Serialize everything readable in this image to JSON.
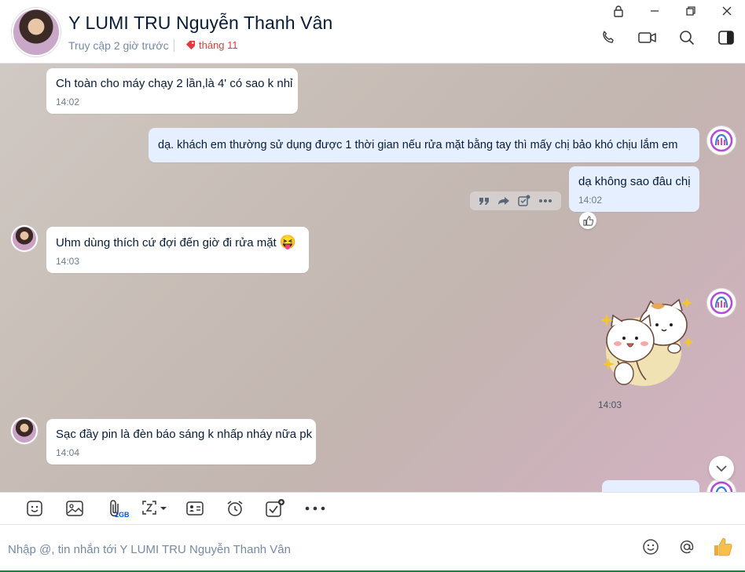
{
  "header": {
    "contact_name": "Y LUMI TRU Nguyễn Thanh Vân",
    "last_seen": "Truy cập 2 giờ trước",
    "tag_label": "tháng 11",
    "tag_color": "#e0393e"
  },
  "window_controls": [
    "lock-icon",
    "minimize-icon",
    "restore-icon",
    "close-icon"
  ],
  "header_actions": [
    "phone-icon",
    "video-call-icon",
    "search-icon",
    "sidebar-toggle-icon"
  ],
  "messages": [
    {
      "sender": "contact",
      "text": "Ch toàn cho máy chạy 2 lần,là 4' có sao k nhỉ",
      "time": "14:02"
    },
    {
      "sender": "me",
      "text": "dạ. khách em thường sử dụng được 1 thời gian nếu rửa mặt bằng tay thì mấy chị bảo khó chịu lắm em"
    },
    {
      "sender": "me",
      "text": "dạ không sao đâu chị",
      "time": "14:02",
      "reaction": "like-icon"
    },
    {
      "sender": "contact",
      "text": "Uhm dùng thích cứ đợi đến giờ đi rửa mặt",
      "emoji": "😝",
      "time": "14:03"
    },
    {
      "sender": "me",
      "type": "sticker",
      "sticker": "two-cats-sticker",
      "time": "14:03"
    },
    {
      "sender": "contact",
      "text": "Sạc đầy pin là đèn báo sáng k nhấp nháy nữa pk",
      "time": "14:04"
    }
  ],
  "message_toolbar": [
    "quote-icon",
    "forward-icon",
    "add-task-icon",
    "more-icon"
  ],
  "composer_toolbar": [
    {
      "icon": "sticker-icon"
    },
    {
      "icon": "image-icon"
    },
    {
      "icon": "attach-icon",
      "sub": "1GB"
    },
    {
      "icon": "screenshot-icon"
    },
    {
      "icon": "contact-card-icon"
    },
    {
      "icon": "reminder-icon"
    },
    {
      "icon": "task-icon"
    },
    {
      "icon": "more-icon"
    }
  ],
  "composer": {
    "placeholder": "Nhập @, tin nhắn tới Y LUMI TRU Nguyễn Thanh Vân",
    "value": ""
  },
  "colors": {
    "my_bubble": "#e5efff",
    "their_bubble": "#ffffff",
    "accent": "#005ae0"
  }
}
